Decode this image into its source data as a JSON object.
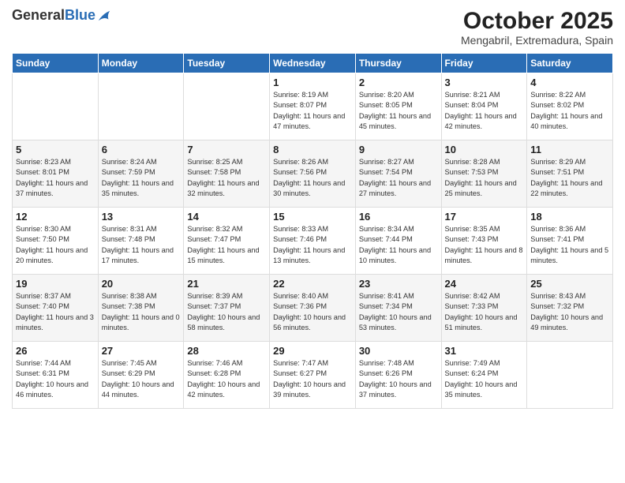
{
  "logo": {
    "general": "General",
    "blue": "Blue"
  },
  "header": {
    "month": "October 2025",
    "location": "Mengabril, Extremadura, Spain"
  },
  "weekdays": [
    "Sunday",
    "Monday",
    "Tuesday",
    "Wednesday",
    "Thursday",
    "Friday",
    "Saturday"
  ],
  "weeks": [
    [
      {
        "day": "",
        "info": ""
      },
      {
        "day": "",
        "info": ""
      },
      {
        "day": "",
        "info": ""
      },
      {
        "day": "1",
        "info": "Sunrise: 8:19 AM\nSunset: 8:07 PM\nDaylight: 11 hours and 47 minutes."
      },
      {
        "day": "2",
        "info": "Sunrise: 8:20 AM\nSunset: 8:05 PM\nDaylight: 11 hours and 45 minutes."
      },
      {
        "day": "3",
        "info": "Sunrise: 8:21 AM\nSunset: 8:04 PM\nDaylight: 11 hours and 42 minutes."
      },
      {
        "day": "4",
        "info": "Sunrise: 8:22 AM\nSunset: 8:02 PM\nDaylight: 11 hours and 40 minutes."
      }
    ],
    [
      {
        "day": "5",
        "info": "Sunrise: 8:23 AM\nSunset: 8:01 PM\nDaylight: 11 hours and 37 minutes."
      },
      {
        "day": "6",
        "info": "Sunrise: 8:24 AM\nSunset: 7:59 PM\nDaylight: 11 hours and 35 minutes."
      },
      {
        "day": "7",
        "info": "Sunrise: 8:25 AM\nSunset: 7:58 PM\nDaylight: 11 hours and 32 minutes."
      },
      {
        "day": "8",
        "info": "Sunrise: 8:26 AM\nSunset: 7:56 PM\nDaylight: 11 hours and 30 minutes."
      },
      {
        "day": "9",
        "info": "Sunrise: 8:27 AM\nSunset: 7:54 PM\nDaylight: 11 hours and 27 minutes."
      },
      {
        "day": "10",
        "info": "Sunrise: 8:28 AM\nSunset: 7:53 PM\nDaylight: 11 hours and 25 minutes."
      },
      {
        "day": "11",
        "info": "Sunrise: 8:29 AM\nSunset: 7:51 PM\nDaylight: 11 hours and 22 minutes."
      }
    ],
    [
      {
        "day": "12",
        "info": "Sunrise: 8:30 AM\nSunset: 7:50 PM\nDaylight: 11 hours and 20 minutes."
      },
      {
        "day": "13",
        "info": "Sunrise: 8:31 AM\nSunset: 7:48 PM\nDaylight: 11 hours and 17 minutes."
      },
      {
        "day": "14",
        "info": "Sunrise: 8:32 AM\nSunset: 7:47 PM\nDaylight: 11 hours and 15 minutes."
      },
      {
        "day": "15",
        "info": "Sunrise: 8:33 AM\nSunset: 7:46 PM\nDaylight: 11 hours and 13 minutes."
      },
      {
        "day": "16",
        "info": "Sunrise: 8:34 AM\nSunset: 7:44 PM\nDaylight: 11 hours and 10 minutes."
      },
      {
        "day": "17",
        "info": "Sunrise: 8:35 AM\nSunset: 7:43 PM\nDaylight: 11 hours and 8 minutes."
      },
      {
        "day": "18",
        "info": "Sunrise: 8:36 AM\nSunset: 7:41 PM\nDaylight: 11 hours and 5 minutes."
      }
    ],
    [
      {
        "day": "19",
        "info": "Sunrise: 8:37 AM\nSunset: 7:40 PM\nDaylight: 11 hours and 3 minutes."
      },
      {
        "day": "20",
        "info": "Sunrise: 8:38 AM\nSunset: 7:38 PM\nDaylight: 11 hours and 0 minutes."
      },
      {
        "day": "21",
        "info": "Sunrise: 8:39 AM\nSunset: 7:37 PM\nDaylight: 10 hours and 58 minutes."
      },
      {
        "day": "22",
        "info": "Sunrise: 8:40 AM\nSunset: 7:36 PM\nDaylight: 10 hours and 56 minutes."
      },
      {
        "day": "23",
        "info": "Sunrise: 8:41 AM\nSunset: 7:34 PM\nDaylight: 10 hours and 53 minutes."
      },
      {
        "day": "24",
        "info": "Sunrise: 8:42 AM\nSunset: 7:33 PM\nDaylight: 10 hours and 51 minutes."
      },
      {
        "day": "25",
        "info": "Sunrise: 8:43 AM\nSunset: 7:32 PM\nDaylight: 10 hours and 49 minutes."
      }
    ],
    [
      {
        "day": "26",
        "info": "Sunrise: 7:44 AM\nSunset: 6:31 PM\nDaylight: 10 hours and 46 minutes."
      },
      {
        "day": "27",
        "info": "Sunrise: 7:45 AM\nSunset: 6:29 PM\nDaylight: 10 hours and 44 minutes."
      },
      {
        "day": "28",
        "info": "Sunrise: 7:46 AM\nSunset: 6:28 PM\nDaylight: 10 hours and 42 minutes."
      },
      {
        "day": "29",
        "info": "Sunrise: 7:47 AM\nSunset: 6:27 PM\nDaylight: 10 hours and 39 minutes."
      },
      {
        "day": "30",
        "info": "Sunrise: 7:48 AM\nSunset: 6:26 PM\nDaylight: 10 hours and 37 minutes."
      },
      {
        "day": "31",
        "info": "Sunrise: 7:49 AM\nSunset: 6:24 PM\nDaylight: 10 hours and 35 minutes."
      },
      {
        "day": "",
        "info": ""
      }
    ]
  ]
}
